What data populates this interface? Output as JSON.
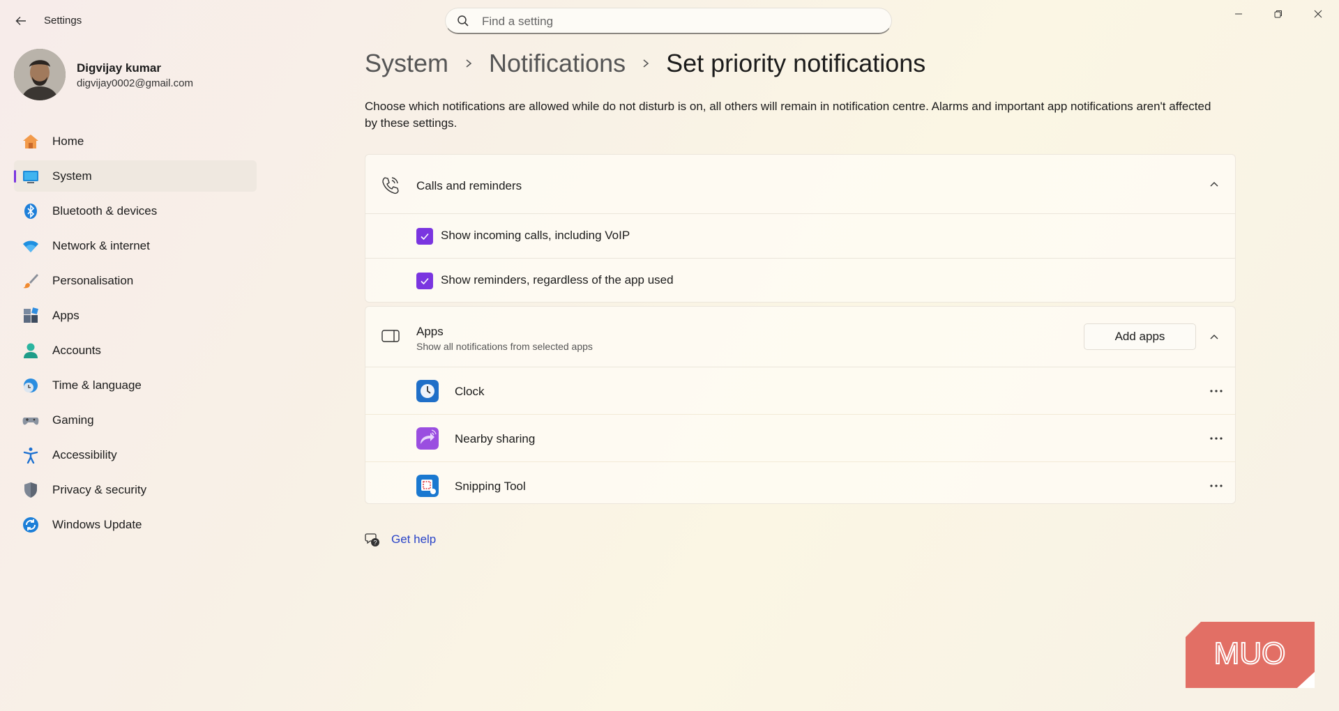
{
  "window": {
    "app_title": "Settings"
  },
  "search": {
    "placeholder": "Find a setting"
  },
  "profile": {
    "name": "Digvijay kumar",
    "email": "digvijay0002@gmail.com"
  },
  "sidebar": {
    "active": "System",
    "items": [
      {
        "label": "Home",
        "icon": "home-icon"
      },
      {
        "label": "System",
        "icon": "system-icon"
      },
      {
        "label": "Bluetooth & devices",
        "icon": "bluetooth-icon"
      },
      {
        "label": "Network & internet",
        "icon": "wifi-icon"
      },
      {
        "label": "Personalisation",
        "icon": "brush-icon"
      },
      {
        "label": "Apps",
        "icon": "apps-icon"
      },
      {
        "label": "Accounts",
        "icon": "account-icon"
      },
      {
        "label": "Time & language",
        "icon": "clock-globe-icon"
      },
      {
        "label": "Gaming",
        "icon": "gamepad-icon"
      },
      {
        "label": "Accessibility",
        "icon": "accessibility-icon"
      },
      {
        "label": "Privacy & security",
        "icon": "shield-icon"
      },
      {
        "label": "Windows Update",
        "icon": "update-icon"
      }
    ]
  },
  "breadcrumb": {
    "items": [
      "System",
      "Notifications"
    ],
    "current": "Set priority notifications"
  },
  "description": "Choose which notifications are allowed while do not disturb is on, all others will remain in notification centre. Alarms and important app notifications aren't affected by these settings.",
  "calls_section": {
    "title": "Calls and reminders",
    "options": [
      {
        "label": "Show incoming calls, including VoIP",
        "checked": true
      },
      {
        "label": "Show reminders, regardless of the app used",
        "checked": true
      }
    ]
  },
  "apps_section": {
    "title": "Apps",
    "subtitle": "Show all notifications from selected apps",
    "add_button": "Add apps",
    "apps": [
      {
        "name": "Clock",
        "icon": "clock-app-icon"
      },
      {
        "name": "Nearby sharing",
        "icon": "nearby-sharing-icon"
      },
      {
        "name": "Snipping Tool",
        "icon": "snipping-tool-icon"
      }
    ]
  },
  "help": {
    "label": "Get help"
  },
  "watermark": {
    "text": "MUO"
  },
  "colors": {
    "accent": "#7a35e0",
    "link": "#2a44c8"
  }
}
